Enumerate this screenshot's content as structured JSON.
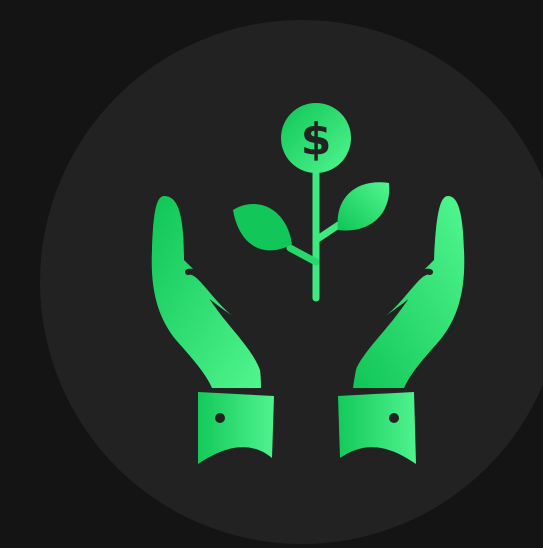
{
  "icon": {
    "name": "investment-growth-icon",
    "symbol": "$"
  },
  "colors": {
    "background": "#141414",
    "circle": "#222222",
    "green_light": "#4cf28c",
    "green_dark": "#10c457"
  }
}
